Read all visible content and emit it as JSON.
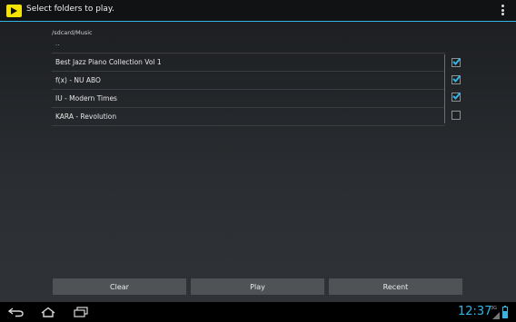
{
  "app": {
    "title": "Select folders to play.",
    "icon": "play-icon",
    "accent": "#33b5e5",
    "brand_color": "#f2e400"
  },
  "path": "/sdcard/Music",
  "list": {
    "parent": "..",
    "items": [
      {
        "label": "Best Jazz Piano Collection Vol 1",
        "checked": true
      },
      {
        "label": "f(x) - NU ABO",
        "checked": true
      },
      {
        "label": "IU - Modern Times",
        "checked": true
      },
      {
        "label": "KARA - Revolution",
        "checked": false
      }
    ]
  },
  "buttons": {
    "clear": "Clear",
    "play": "Play",
    "recent": "Recent"
  },
  "system": {
    "time": "12:37",
    "status_small": "3G"
  }
}
